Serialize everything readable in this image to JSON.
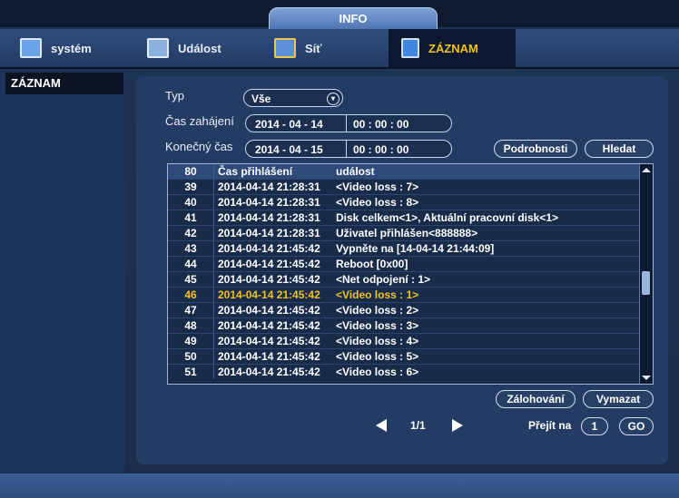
{
  "header": {
    "title": "INFO"
  },
  "tabs": [
    {
      "label": "systém",
      "icon": "monitor-icon"
    },
    {
      "label": "Událost",
      "icon": "event-icon"
    },
    {
      "label": "Síť",
      "icon": "network-icon"
    },
    {
      "label": "ZÁZNAM",
      "icon": "log-book-icon",
      "active": true
    }
  ],
  "sidebar": {
    "items": [
      {
        "label": "ZÁZNAM"
      }
    ]
  },
  "filter": {
    "type_label": "Typ",
    "type_value": "Vše",
    "start_label": "Čas zahájení",
    "start_date": "2014 - 04 - 14",
    "start_time": "00 : 00 : 00",
    "end_label": "Konečný čas",
    "end_date": "2014 - 04 - 15",
    "end_time": "00 : 00 : 00",
    "details_button": "Podrobnosti",
    "search_button": "Hledat"
  },
  "table": {
    "count": "80",
    "columns": [
      "Čas přihlášení",
      "událost"
    ],
    "rows": [
      {
        "no": "39",
        "time": "2014-04-14 21:28:31",
        "event": "<Video loss : 7>"
      },
      {
        "no": "40",
        "time": "2014-04-14 21:28:31",
        "event": "<Video loss : 8>"
      },
      {
        "no": "41",
        "time": "2014-04-14 21:28:31",
        "event": "Disk celkem<1>, Aktuální pracovní disk<1>"
      },
      {
        "no": "42",
        "time": "2014-04-14 21:28:31",
        "event": "Uživatel přihlášen<888888>"
      },
      {
        "no": "43",
        "time": "2014-04-14 21:45:42",
        "event": "Vypněte na [14-04-14 21:44:09]"
      },
      {
        "no": "44",
        "time": "2014-04-14 21:45:42",
        "event": "Reboot [0x00]"
      },
      {
        "no": "45",
        "time": "2014-04-14 21:45:42",
        "event": "<Net odpojení : 1>"
      },
      {
        "no": "46",
        "time": "2014-04-14 21:45:42",
        "event": "<Video loss : 1>",
        "selected": true
      },
      {
        "no": "47",
        "time": "2014-04-14 21:45:42",
        "event": "<Video loss : 2>"
      },
      {
        "no": "48",
        "time": "2014-04-14 21:45:42",
        "event": "<Video loss : 3>"
      },
      {
        "no": "49",
        "time": "2014-04-14 21:45:42",
        "event": "<Video loss : 4>"
      },
      {
        "no": "50",
        "time": "2014-04-14 21:45:42",
        "event": "<Video loss : 5>"
      },
      {
        "no": "51",
        "time": "2014-04-14 21:45:42",
        "event": "<Video loss : 6>"
      }
    ]
  },
  "actions": {
    "backup_button": "Zálohování",
    "clear_button": "Vymazat"
  },
  "pager": {
    "page": "1/1",
    "goto_label": "Přejít na",
    "goto_value": "1",
    "go_button": "GO"
  },
  "colors": {
    "selected_text": "#f3c21a",
    "panel": "#243c63"
  }
}
